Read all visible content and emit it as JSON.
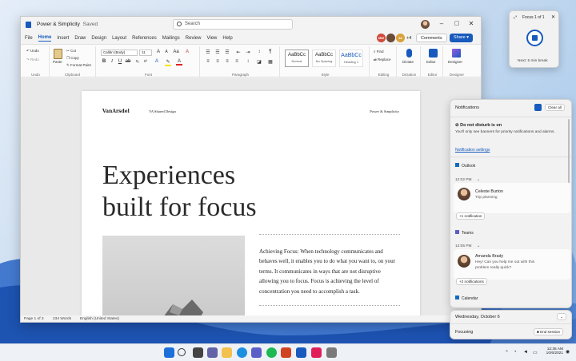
{
  "window": {
    "title": "Power & Simplicity",
    "saved": "Saved",
    "search_placeholder": "Search",
    "collab_count": "+4",
    "comments_label": "Comments",
    "share_label": "Share"
  },
  "menu": [
    "File",
    "Home",
    "Insert",
    "Draw",
    "Design",
    "Layout",
    "References",
    "Mailings",
    "Review",
    "View",
    "Help"
  ],
  "ribbon": {
    "undo": "Undo",
    "redo": "Redo",
    "paste": "Paste",
    "cut": "Cut",
    "copy": "Copy",
    "format_painter": "Format Paint",
    "font_name": "Calibri (Body)",
    "font_size": "11",
    "styles": [
      {
        "sample": "AaBbCc",
        "name": "Normal"
      },
      {
        "sample": "AaBbCc",
        "name": "No Spacing"
      },
      {
        "sample": "AaBbCc",
        "name": "Heading 1"
      }
    ],
    "find": "Find",
    "replace": "Replace",
    "dictate": "Dictate",
    "editor": "Editor",
    "designer": "Designer",
    "groups": [
      "Undo",
      "Clipboard",
      "Font",
      "Paragraph",
      "Style",
      "Editing",
      "Dictation",
      "Editor",
      "Designer"
    ]
  },
  "document": {
    "brand": "VanArsdel",
    "header_mid": "VA Shared Design",
    "header_right": "Power & Simplicity",
    "hero_line1": "Experiences",
    "hero_line2": "built for focus",
    "body": "Achieving Focus: When technology communicates and behaves well, it enables you to do what you want to, on your terms. It communicates in ways that are not disruptive allowing you to focus. Focus is achieving the level of concentration you need to accomplish a task."
  },
  "status": {
    "page": "Page 1 of 3",
    "words": "234 Words",
    "language": "English (United States)"
  },
  "notifications": {
    "title": "Notifications",
    "clear_all": "Clear all",
    "dnd_title": "Do not disturb is on",
    "dnd_body": "You'll only see banners for priority notifications and alarms.",
    "settings_link": "Notification settings",
    "outlook_app": "Outlook",
    "outlook_time": "12:02 PM",
    "outlook_sender": "Celeste Burton",
    "outlook_msg": "Trip planning",
    "outlook_more": "+1 notification",
    "teams_app": "Teams",
    "teams_time": "12:05 PM",
    "teams_sender": "Amanda Brady",
    "teams_msg": "Hey! Can you help me out with this problem really quick?",
    "teams_more": "+2 notifications",
    "calendar_app": "Calendar"
  },
  "calendar": {
    "date": "Wednesday, October 6",
    "focusing": "Focusing",
    "end_session": "End session"
  },
  "focus_timer": {
    "title": "Focus 1 of 1",
    "next": "Next: 5 min break"
  },
  "tray": {
    "time": "12:35 AM",
    "date": "10/6/2021"
  }
}
